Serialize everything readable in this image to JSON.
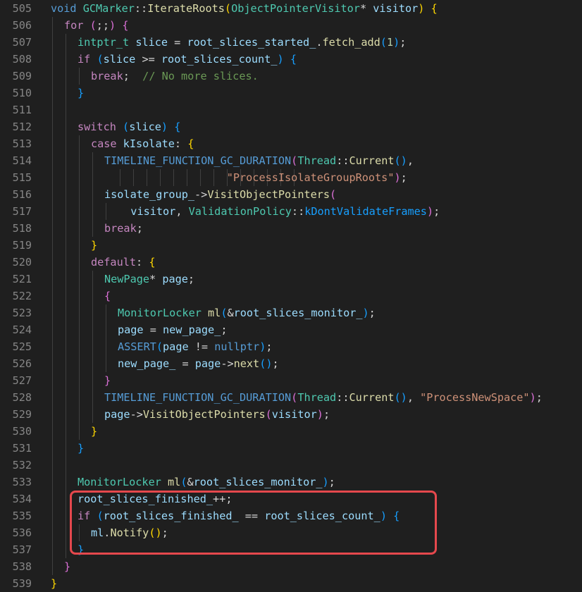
{
  "editor": {
    "lines": [
      {
        "num": "505",
        "indent": 0,
        "tokens": [
          [
            "void",
            "kw"
          ],
          [
            " ",
            ""
          ],
          [
            "GCMarker",
            "type"
          ],
          [
            "::",
            "op"
          ],
          [
            "IterateRoots",
            "fn"
          ],
          [
            "(",
            "p1"
          ],
          [
            "ObjectPointerVisitor",
            "type"
          ],
          [
            "*",
            "op"
          ],
          [
            " ",
            ""
          ],
          [
            "visitor",
            "var"
          ],
          [
            ")",
            "p1"
          ],
          [
            " ",
            ""
          ],
          [
            "{",
            "p1"
          ]
        ]
      },
      {
        "num": "506",
        "indent": 1,
        "tokens": [
          [
            "for",
            "ctrl"
          ],
          [
            " ",
            ""
          ],
          [
            "(",
            "p2"
          ],
          [
            ";;",
            "op"
          ],
          [
            ")",
            "p2"
          ],
          [
            " ",
            ""
          ],
          [
            "{",
            "p2"
          ]
        ]
      },
      {
        "num": "507",
        "indent": 2,
        "tokens": [
          [
            "intptr_t",
            "type"
          ],
          [
            " ",
            ""
          ],
          [
            "slice",
            "var"
          ],
          [
            " = ",
            "op"
          ],
          [
            "root_slices_started_",
            "var"
          ],
          [
            ".",
            "op"
          ],
          [
            "fetch_add",
            "fn"
          ],
          [
            "(",
            "p3"
          ],
          [
            "1",
            "num"
          ],
          [
            ")",
            "p3"
          ],
          [
            ";",
            "op"
          ]
        ]
      },
      {
        "num": "508",
        "indent": 2,
        "tokens": [
          [
            "if",
            "ctrl"
          ],
          [
            " ",
            ""
          ],
          [
            "(",
            "p3"
          ],
          [
            "slice",
            "var"
          ],
          [
            " >= ",
            "op"
          ],
          [
            "root_slices_count_",
            "var"
          ],
          [
            ")",
            "p3"
          ],
          [
            " ",
            ""
          ],
          [
            "{",
            "p3"
          ]
        ]
      },
      {
        "num": "509",
        "indent": 3,
        "tokens": [
          [
            "break",
            "ctrl"
          ],
          [
            ";",
            "op"
          ],
          [
            "  ",
            ""
          ],
          [
            "// No more slices.",
            "com"
          ]
        ]
      },
      {
        "num": "510",
        "indent": 2,
        "tokens": [
          [
            "}",
            "p3"
          ]
        ]
      },
      {
        "num": "511",
        "indent": 2,
        "tokens": []
      },
      {
        "num": "512",
        "indent": 2,
        "tokens": [
          [
            "switch",
            "ctrl"
          ],
          [
            " ",
            ""
          ],
          [
            "(",
            "p3"
          ],
          [
            "slice",
            "var"
          ],
          [
            ")",
            "p3"
          ],
          [
            " ",
            ""
          ],
          [
            "{",
            "p3"
          ]
        ]
      },
      {
        "num": "513",
        "indent": 3,
        "tokens": [
          [
            "case",
            "ctrl"
          ],
          [
            " ",
            ""
          ],
          [
            "kIsolate",
            "var"
          ],
          [
            ":",
            "op"
          ],
          [
            " ",
            ""
          ],
          [
            "{",
            "p1"
          ]
        ]
      },
      {
        "num": "514",
        "indent": 4,
        "tokens": [
          [
            "TIMELINE_FUNCTION_GC_DURATION",
            "kw"
          ],
          [
            "(",
            "p2"
          ],
          [
            "Thread",
            "type"
          ],
          [
            "::",
            "op"
          ],
          [
            "Current",
            "fn"
          ],
          [
            "(",
            "p3"
          ],
          [
            ")",
            "p3"
          ],
          [
            ",",
            "op"
          ]
        ]
      },
      {
        "num": "515",
        "indent": 4,
        "guides_extra": [
          170,
          189,
          208,
          227,
          246,
          265,
          284,
          303,
          322,
          341,
          360,
          379,
          398,
          417
        ],
        "tokens": [
          [
            "                   ",
            ""
          ],
          [
            "\"ProcessIsolateGroupRoots\"",
            "str"
          ],
          [
            ")",
            "p2"
          ],
          [
            ";",
            "op"
          ]
        ]
      },
      {
        "num": "516",
        "indent": 4,
        "tokens": [
          [
            "isolate_group_",
            "var"
          ],
          [
            "->",
            "op"
          ],
          [
            "VisitObjectPointers",
            "fn"
          ],
          [
            "(",
            "p2"
          ]
        ]
      },
      {
        "num": "517",
        "indent": 5,
        "tokens": [
          [
            "  ",
            ""
          ],
          [
            "visitor",
            "var"
          ],
          [
            ", ",
            "op"
          ],
          [
            "ValidationPolicy",
            "type"
          ],
          [
            "::",
            "op"
          ],
          [
            "kDontValidateFrames",
            "p3"
          ],
          [
            ")",
            "p2"
          ],
          [
            ";",
            "op"
          ]
        ]
      },
      {
        "num": "518",
        "indent": 4,
        "tokens": [
          [
            "break",
            "ctrl"
          ],
          [
            ";",
            "op"
          ]
        ]
      },
      {
        "num": "519",
        "indent": 3,
        "tokens": [
          [
            "}",
            "p1"
          ]
        ]
      },
      {
        "num": "520",
        "indent": 3,
        "tokens": [
          [
            "default",
            "ctrl"
          ],
          [
            ":",
            "op"
          ],
          [
            " ",
            ""
          ],
          [
            "{",
            "p1"
          ]
        ]
      },
      {
        "num": "521",
        "indent": 4,
        "tokens": [
          [
            "NewPage",
            "type"
          ],
          [
            "*",
            "op"
          ],
          [
            " ",
            ""
          ],
          [
            "page",
            "var"
          ],
          [
            ";",
            "op"
          ]
        ]
      },
      {
        "num": "522",
        "indent": 4,
        "tokens": [
          [
            "{",
            "p2"
          ]
        ]
      },
      {
        "num": "523",
        "indent": 5,
        "tokens": [
          [
            "MonitorLocker",
            "type"
          ],
          [
            " ",
            ""
          ],
          [
            "ml",
            "fn"
          ],
          [
            "(",
            "p3"
          ],
          [
            "&",
            "op"
          ],
          [
            "root_slices_monitor_",
            "var"
          ],
          [
            ")",
            "p3"
          ],
          [
            ";",
            "op"
          ]
        ]
      },
      {
        "num": "524",
        "indent": 5,
        "tokens": [
          [
            "page",
            "var"
          ],
          [
            " = ",
            "op"
          ],
          [
            "new_page_",
            "var"
          ],
          [
            ";",
            "op"
          ]
        ]
      },
      {
        "num": "525",
        "indent": 5,
        "tokens": [
          [
            "ASSERT",
            "kw"
          ],
          [
            "(",
            "p3"
          ],
          [
            "page",
            "var"
          ],
          [
            " != ",
            "op"
          ],
          [
            "nullptr",
            "kw"
          ],
          [
            ")",
            "p3"
          ],
          [
            ";",
            "op"
          ]
        ]
      },
      {
        "num": "526",
        "indent": 5,
        "tokens": [
          [
            "new_page_",
            "var"
          ],
          [
            " = ",
            "op"
          ],
          [
            "page",
            "var"
          ],
          [
            "->",
            "op"
          ],
          [
            "next",
            "fn"
          ],
          [
            "(",
            "p3"
          ],
          [
            ")",
            "p3"
          ],
          [
            ";",
            "op"
          ]
        ]
      },
      {
        "num": "527",
        "indent": 4,
        "tokens": [
          [
            "}",
            "p2"
          ]
        ]
      },
      {
        "num": "528",
        "indent": 4,
        "tokens": [
          [
            "TIMELINE_FUNCTION_GC_DURATION",
            "kw"
          ],
          [
            "(",
            "p2"
          ],
          [
            "Thread",
            "type"
          ],
          [
            "::",
            "op"
          ],
          [
            "Current",
            "fn"
          ],
          [
            "(",
            "p3"
          ],
          [
            ")",
            "p3"
          ],
          [
            ", ",
            "op"
          ],
          [
            "\"ProcessNewSpace\"",
            "str"
          ],
          [
            ")",
            "p2"
          ],
          [
            ";",
            "op"
          ]
        ]
      },
      {
        "num": "529",
        "indent": 4,
        "tokens": [
          [
            "page",
            "var"
          ],
          [
            "->",
            "op"
          ],
          [
            "VisitObjectPointers",
            "fn"
          ],
          [
            "(",
            "p2"
          ],
          [
            "visitor",
            "var"
          ],
          [
            ")",
            "p2"
          ],
          [
            ";",
            "op"
          ]
        ]
      },
      {
        "num": "530",
        "indent": 3,
        "tokens": [
          [
            "}",
            "p1"
          ]
        ]
      },
      {
        "num": "531",
        "indent": 2,
        "tokens": [
          [
            "}",
            "p3"
          ]
        ]
      },
      {
        "num": "532",
        "indent": 2,
        "tokens": []
      },
      {
        "num": "533",
        "indent": 2,
        "tokens": [
          [
            "MonitorLocker",
            "type"
          ],
          [
            " ",
            ""
          ],
          [
            "ml",
            "fn"
          ],
          [
            "(",
            "p3"
          ],
          [
            "&",
            "op"
          ],
          [
            "root_slices_monitor_",
            "var"
          ],
          [
            ")",
            "p3"
          ],
          [
            ";",
            "op"
          ]
        ]
      },
      {
        "num": "534",
        "indent": 2,
        "tokens": [
          [
            "root_slices_finished_",
            "var"
          ],
          [
            "++;",
            "op"
          ]
        ]
      },
      {
        "num": "535",
        "indent": 2,
        "tokens": [
          [
            "if",
            "ctrl"
          ],
          [
            " ",
            ""
          ],
          [
            "(",
            "p3"
          ],
          [
            "root_slices_finished_",
            "var"
          ],
          [
            " == ",
            "op"
          ],
          [
            "root_slices_count_",
            "var"
          ],
          [
            ")",
            "p3"
          ],
          [
            " ",
            ""
          ],
          [
            "{",
            "p3"
          ]
        ]
      },
      {
        "num": "536",
        "indent": 3,
        "tokens": [
          [
            "ml",
            "var"
          ],
          [
            ".",
            "op"
          ],
          [
            "Notify",
            "fn"
          ],
          [
            "(",
            "p1"
          ],
          [
            ")",
            "p1"
          ],
          [
            ";",
            "op"
          ]
        ]
      },
      {
        "num": "537",
        "indent": 2,
        "tokens": [
          [
            "}",
            "p3"
          ]
        ]
      },
      {
        "num": "538",
        "indent": 1,
        "tokens": [
          [
            "}",
            "p2"
          ]
        ]
      },
      {
        "num": "539",
        "indent": 0,
        "tokens": [
          [
            "}",
            "p1"
          ]
        ]
      }
    ]
  }
}
